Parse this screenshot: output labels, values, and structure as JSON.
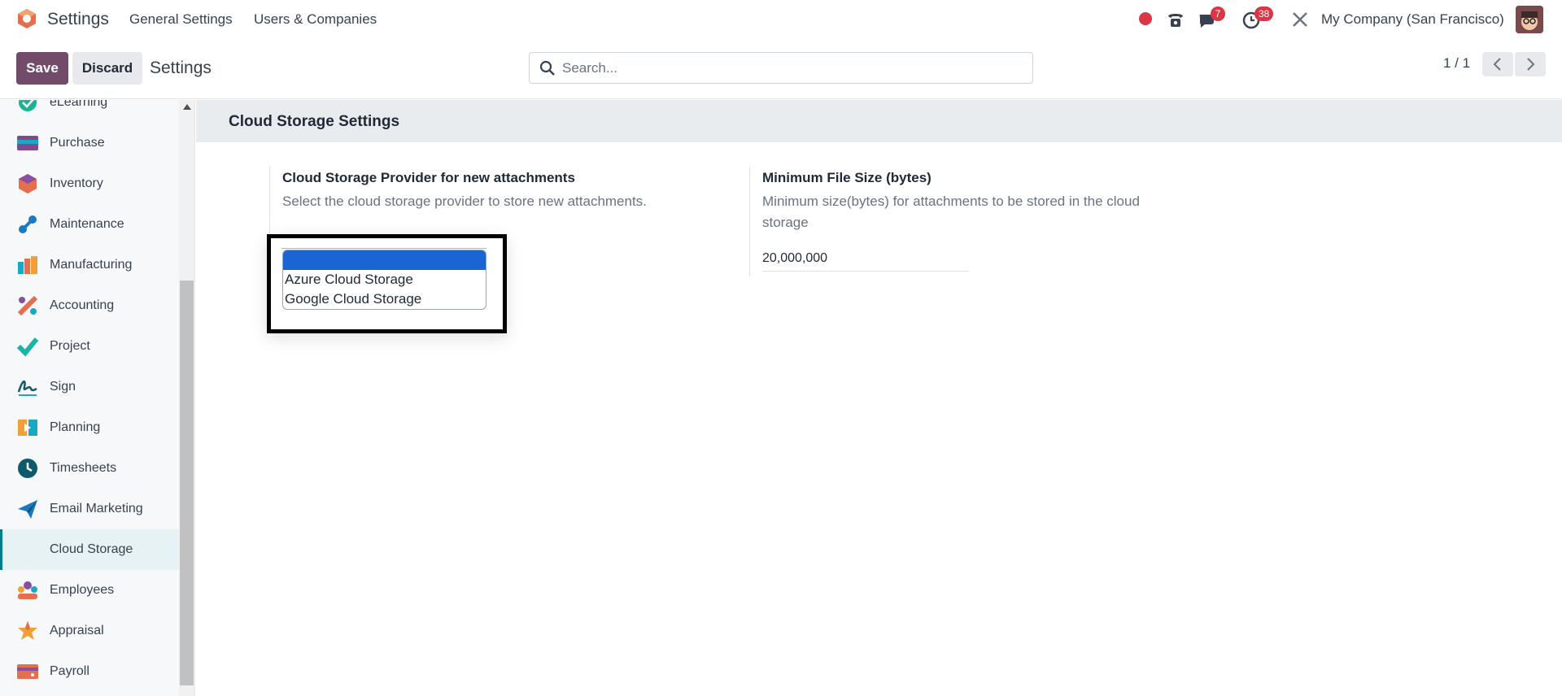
{
  "app": {
    "title": "Settings",
    "menu": [
      "General Settings",
      "Users & Companies"
    ],
    "company": "My Company (San Francisco)",
    "badges": {
      "chat": "7",
      "activity": "38"
    },
    "colors": {
      "brand": "#714b67",
      "accent": "#017e84",
      "danger": "#dc3545",
      "select_highlight": "#1a64d4"
    }
  },
  "controls": {
    "save_label": "Save",
    "discard_label": "Discard",
    "breadcrumb": "Settings",
    "search_placeholder": "Search...",
    "pager": "1 / 1"
  },
  "sidebar": {
    "items": [
      {
        "label": "eLearning",
        "icon": "elearning-icon"
      },
      {
        "label": "Purchase",
        "icon": "purchase-icon"
      },
      {
        "label": "Inventory",
        "icon": "inventory-icon"
      },
      {
        "label": "Maintenance",
        "icon": "maintenance-icon"
      },
      {
        "label": "Manufacturing",
        "icon": "manufacturing-icon"
      },
      {
        "label": "Accounting",
        "icon": "accounting-icon"
      },
      {
        "label": "Project",
        "icon": "project-icon"
      },
      {
        "label": "Sign",
        "icon": "sign-icon"
      },
      {
        "label": "Planning",
        "icon": "planning-icon"
      },
      {
        "label": "Timesheets",
        "icon": "timesheets-icon"
      },
      {
        "label": "Email Marketing",
        "icon": "email-marketing-icon"
      },
      {
        "label": "Cloud Storage",
        "icon": "",
        "active": true
      },
      {
        "label": "Employees",
        "icon": "employees-icon"
      },
      {
        "label": "Appraisal",
        "icon": "appraisal-icon"
      },
      {
        "label": "Payroll",
        "icon": "payroll-icon"
      }
    ]
  },
  "main": {
    "section_title": "Cloud Storage Settings",
    "provider": {
      "title": "Cloud Storage Provider for new attachments",
      "description": "Select the cloud storage provider to store new attachments.",
      "selected": "",
      "options": [
        "",
        "Azure Cloud Storage",
        "Google Cloud Storage"
      ]
    },
    "min_size": {
      "title": "Minimum File Size (bytes)",
      "description": "Minimum size(bytes) for attachments to be stored in the cloud storage",
      "value": "20,000,000"
    }
  }
}
